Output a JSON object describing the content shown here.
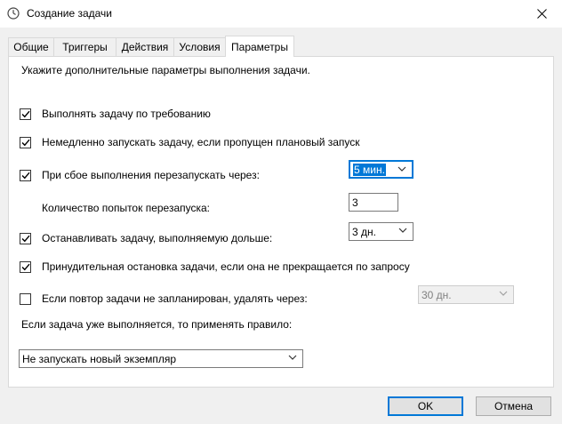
{
  "window": {
    "title": "Создание задачи",
    "icon": "clock-icon"
  },
  "tabs": [
    {
      "label": "Общие",
      "active": false
    },
    {
      "label": "Триггеры",
      "active": false
    },
    {
      "label": "Действия",
      "active": false
    },
    {
      "label": "Условия",
      "active": false
    },
    {
      "label": "Параметры",
      "active": true
    }
  ],
  "settings": {
    "intro": "Укажите дополнительные параметры выполнения задачи.",
    "run_on_demand": {
      "label": "Выполнять задачу по требованию",
      "checked": true
    },
    "run_missed": {
      "label": "Немедленно запускать задачу, если пропущен плановый запуск",
      "checked": true
    },
    "restart_on_fail": {
      "label": "При сбое выполнения перезапускать через:",
      "checked": true,
      "value": "5 мин."
    },
    "restart_count": {
      "label": "Количество попыток перезапуска:",
      "value": "3"
    },
    "stop_if_longer": {
      "label": "Останавливать задачу, выполняемую дольше:",
      "checked": true,
      "value": "3 дн."
    },
    "force_stop": {
      "label": "Принудительная остановка задачи, если она не прекращается по запросу",
      "checked": true
    },
    "delete_if_not_scheduled": {
      "label": "Если повтор задачи не запланирован, удалять через:",
      "checked": false,
      "value": "30 дн."
    },
    "running_rule_label": "Если задача уже выполняется, то применять правило:",
    "running_rule_value": "Не запускать новый экземпляр"
  },
  "buttons": {
    "ok": "OK",
    "cancel": "Отмена"
  },
  "colors": {
    "accent": "#0078d7"
  }
}
